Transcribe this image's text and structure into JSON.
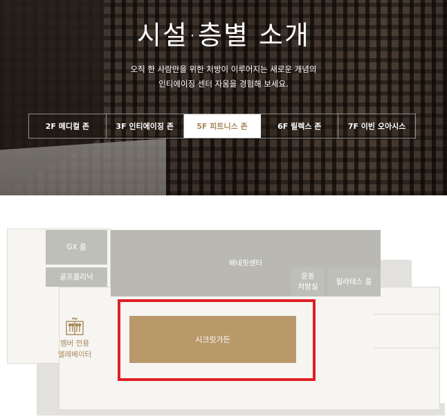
{
  "hero": {
    "title": "시설·층별 소개",
    "description_line1": "오직 한 사람만을 위한 처방이 이루어지는 새로운 개념의",
    "description_line2": "인티에이징 센터 자움을 경험해 보세요."
  },
  "floor_tabs": [
    {
      "label": "2F 메디컬 존",
      "active": false
    },
    {
      "label": "3F 인티에이징 존",
      "active": false
    },
    {
      "label": "5F 피트니스 존",
      "active": true
    },
    {
      "label": "6F 릴렉스 존",
      "active": false
    },
    {
      "label": "7F 이빈 오아시스",
      "active": false
    }
  ],
  "map": {
    "rooms": {
      "gx": "GX 룸",
      "golf": "골프클리닉",
      "benefit": "베네핏센터",
      "exercise_line1": "운동",
      "exercise_line2": "처방실",
      "pilates": "필라테스 룸",
      "secret_garden": "시크릿가든"
    },
    "elevator": {
      "icon": "elevator-icon",
      "label_line1": "멤버 전용",
      "label_line2": "엘레베이터"
    },
    "colors": {
      "room_gray": "#bfbfb9",
      "highlight_room": "#b9986a",
      "highlight_frame": "#e01e25",
      "accent_text": "#a7875a"
    }
  }
}
